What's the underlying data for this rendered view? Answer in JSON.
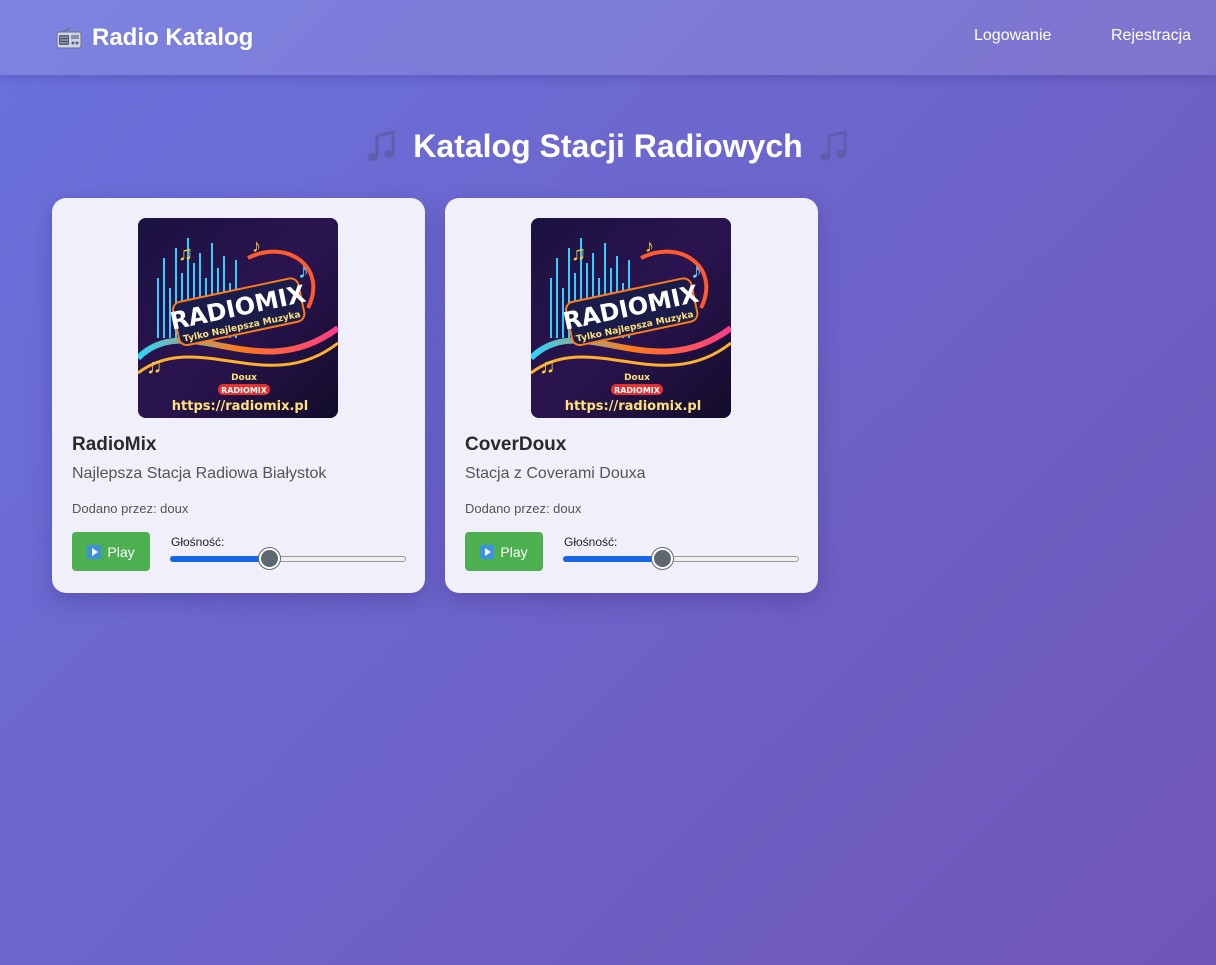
{
  "navbar": {
    "brand_icon": "radio-icon",
    "brand_label": "Radio Katalog",
    "login_label": "Logowanie",
    "register_label": "Rejestracja"
  },
  "page": {
    "title": "Katalog Stacji Radiowych",
    "title_icon": "music-note-icon"
  },
  "stations": [
    {
      "name": "RadioMix",
      "description": "Najlepsza Stacja Radiowa Białystok",
      "added_by": "Dodano przez: doux",
      "play_label": "Play",
      "volume_label": "Głośność:",
      "volume": 0.42,
      "cover": {
        "title": "RADIOMIX",
        "subtitle": "Tylko Najlepsza Muzyka",
        "tag_top": "Doux",
        "tag_badge": "RADIOMIX",
        "url": "https://radiomix.pl"
      }
    },
    {
      "name": "CoverDoux",
      "description": "Stacja z Coverami Douxa",
      "added_by": "Dodano przez: doux",
      "play_label": "Play",
      "volume_label": "Głośność:",
      "volume": 0.42,
      "cover": {
        "title": "RADIOMIX",
        "subtitle": "Tylko Najlepsza Muzyka",
        "tag_top": "Doux",
        "tag_badge": "RADIOMIX",
        "url": "https://radiomix.pl"
      }
    }
  ],
  "colors": {
    "background_start": "#6a72dd",
    "background_end": "#7056b6",
    "card_background": "#f0effa",
    "play_button": "#4caf50",
    "slider_fill": "#1768e5"
  }
}
